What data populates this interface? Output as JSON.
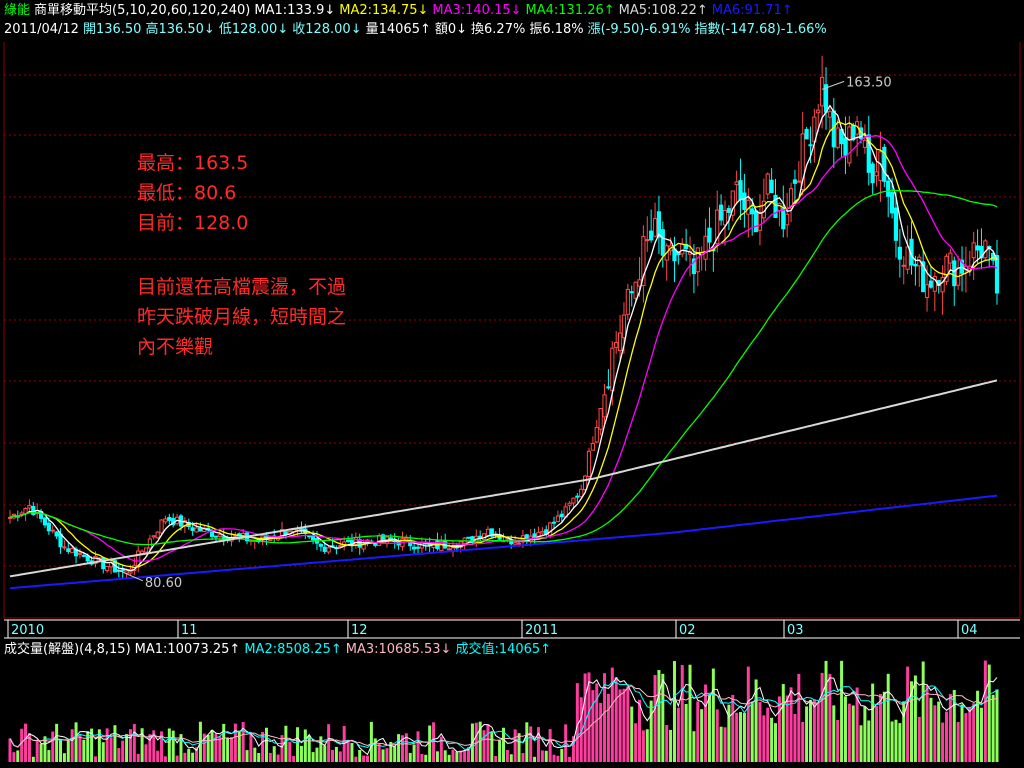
{
  "header1": {
    "stock": "綠能",
    "indicator": "商單移動平均(5,10,20,60,120,240)",
    "ma": [
      {
        "label": "MA1:133.9",
        "arrow": "↓",
        "color": "#ffffff"
      },
      {
        "label": "MA2:134.75",
        "arrow": "↓",
        "color": "#ffff00"
      },
      {
        "label": "MA3:140.15",
        "arrow": "↓",
        "color": "#ff00ff"
      },
      {
        "label": "MA4:131.26",
        "arrow": "↑",
        "color": "#00ff00"
      },
      {
        "label": "MA5:108.22",
        "arrow": "↑",
        "color": "#d8d8d8"
      },
      {
        "label": "MA6:91.71",
        "arrow": "↑",
        "color": "#1a1aff"
      }
    ]
  },
  "header2": {
    "date": "2011/04/12",
    "items": [
      {
        "text": "開136.50",
        "color": "#7fffff"
      },
      {
        "text": "高136.50↓",
        "color": "#7fffff"
      },
      {
        "text": "低128.00↓",
        "color": "#7fffff"
      },
      {
        "text": "收128.00↓",
        "color": "#7fffff"
      },
      {
        "text": "量14065↑",
        "color": "#ffffff"
      },
      {
        "text": "額0↓",
        "color": "#ffffff"
      },
      {
        "text": "換6.27%",
        "color": "#ffffff"
      },
      {
        "text": "振6.18%",
        "color": "#ffffff"
      },
      {
        "text": "漲(-9.50)-6.91%",
        "color": "#7fffff"
      },
      {
        "text": "指數(-147.68)-1.66%",
        "color": "#7fffff"
      }
    ]
  },
  "volume_header": {
    "title": "成交量(解盤)(4,8,15)",
    "ma": [
      {
        "label": "MA1:10073.25↑",
        "color": "#ffffff"
      },
      {
        "label": "MA2:8508.25↑",
        "color": "#00ffff"
      },
      {
        "label": "MA3:10685.53↓",
        "color": "#ffb6c1"
      },
      {
        "label": "成交值:14065↑",
        "color": "#00ffff"
      }
    ]
  },
  "annotation": {
    "lines": [
      "最高：163.5",
      "最低：80.6",
      "目前：128.0"
    ],
    "comment_lines": [
      "目前還在高檔震盪，不過",
      "昨天跌破月線，短時間之",
      "內不樂觀"
    ]
  },
  "chart_data": {
    "type": "candlestick",
    "high_label": "163.50",
    "low_label": "80.60",
    "x_labels": [
      "2010",
      "11",
      "12",
      "2011",
      "02",
      "03",
      "04"
    ],
    "price_high": 163.5,
    "price_low": 80.6,
    "last_close": 128.0,
    "colors": {
      "up": "#ff4a4a",
      "down": "#00ffff",
      "grid": "#a00000",
      "ma": [
        "#ffffff",
        "#ffff00",
        "#ff00ff",
        "#00ff00",
        "#d8d8d8",
        "#1a1aff"
      ],
      "vol_up": "#ff3ca0",
      "vol_down": "#8cff5a"
    }
  }
}
